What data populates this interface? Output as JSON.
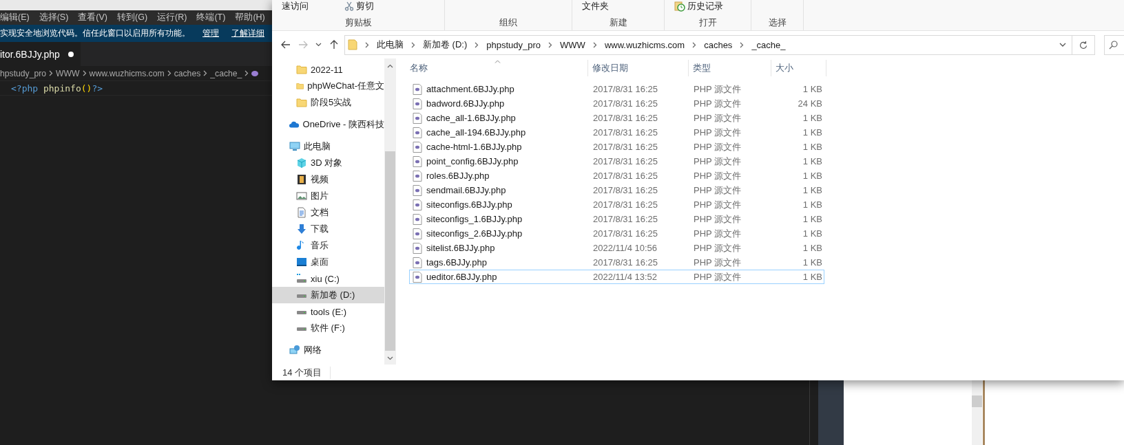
{
  "editor": {
    "menu": [
      "编辑(E)",
      "选择(S)",
      "查看(V)",
      "转到(G)",
      "运行(R)",
      "终端(T)",
      "帮助(H)"
    ],
    "trust_banner": {
      "message": "实现安全地浏览代码。信任此窗口以启用所有功能。",
      "links": [
        "管理",
        "了解详细"
      ]
    },
    "tabs": [
      {
        "label": "itor.6BJJy.php",
        "modified": true
      }
    ],
    "breadcrumb": [
      "hpstudy_pro",
      "WWW",
      "www.wuzhicms.com",
      "caches",
      "_cache_"
    ],
    "code_line": [
      {
        "text": "<?php",
        "kind": "tag"
      },
      {
        "text": " phpinfo",
        "kind": "func"
      },
      {
        "text": "()",
        "kind": "paren"
      },
      {
        "text": "?>",
        "kind": "tag"
      }
    ]
  },
  "explorer": {
    "ribbon": {
      "groups": [
        {
          "label": "剪贴板",
          "items": [
            {
              "kind": "text",
              "label": "速访问"
            },
            {
              "kind": "cut",
              "label": "剪切"
            }
          ]
        },
        {
          "label": "组织"
        },
        {
          "label": "新建",
          "items": [
            {
              "kind": "text",
              "label": "文件夹"
            }
          ]
        },
        {
          "label": "打开",
          "items": [
            {
              "kind": "history",
              "label": "历史记录"
            }
          ]
        },
        {
          "label": "选择"
        }
      ]
    },
    "address": {
      "path": [
        "此电脑",
        "新加卷 (D:)",
        "phpstudy_pro",
        "WWW",
        "www.wuzhicms.com",
        "caches",
        "_cache_"
      ]
    },
    "sidebar": {
      "pinned": [
        {
          "label": "2022-11",
          "kind": "folder",
          "selected": false
        },
        {
          "label": "phpWeChat-任意文",
          "kind": "folder",
          "selected": false
        },
        {
          "label": "阶段5实战",
          "kind": "folder",
          "selected": false
        }
      ],
      "locations": [
        {
          "label": "OneDrive - 陕西科技",
          "kind": "cloud",
          "selected": false
        },
        {
          "label": "此电脑",
          "kind": "pc",
          "selected": false,
          "children": [
            {
              "label": "3D 对象",
              "kind": "cube",
              "selected": false
            },
            {
              "label": "视频",
              "kind": "video",
              "selected": false
            },
            {
              "label": "图片",
              "kind": "picture",
              "selected": false
            },
            {
              "label": "文档",
              "kind": "document",
              "selected": false
            },
            {
              "label": "下载",
              "kind": "download",
              "selected": false
            },
            {
              "label": "音乐",
              "kind": "music",
              "selected": false
            },
            {
              "label": "桌面",
              "kind": "desktop",
              "selected": false
            },
            {
              "label": "xiu (C:)",
              "kind": "system_drive",
              "selected": false
            },
            {
              "label": "新加卷 (D:)",
              "kind": "drive",
              "selected": true
            },
            {
              "label": "tools (E:)",
              "kind": "drive",
              "selected": false
            },
            {
              "label": "软件 (F:)",
              "kind": "drive",
              "selected": false
            }
          ]
        },
        {
          "label": "网络",
          "kind": "network",
          "selected": false
        }
      ]
    },
    "columns": [
      "名称",
      "修改日期",
      "类型",
      "大小"
    ],
    "files": [
      {
        "name": "attachment.6BJJy.php",
        "modified": "2017/8/31 16:25",
        "type": "PHP 源文件",
        "size": "1 KB",
        "selected": false
      },
      {
        "name": "badword.6BJJy.php",
        "modified": "2017/8/31 16:25",
        "type": "PHP 源文件",
        "size": "24 KB",
        "selected": false
      },
      {
        "name": "cache_all-1.6BJJy.php",
        "modified": "2017/8/31 16:25",
        "type": "PHP 源文件",
        "size": "1 KB",
        "selected": false
      },
      {
        "name": "cache_all-194.6BJJy.php",
        "modified": "2017/8/31 16:25",
        "type": "PHP 源文件",
        "size": "1 KB",
        "selected": false
      },
      {
        "name": "cache-html-1.6BJJy.php",
        "modified": "2017/8/31 16:25",
        "type": "PHP 源文件",
        "size": "1 KB",
        "selected": false
      },
      {
        "name": "point_config.6BJJy.php",
        "modified": "2017/8/31 16:25",
        "type": "PHP 源文件",
        "size": "1 KB",
        "selected": false
      },
      {
        "name": "roles.6BJJy.php",
        "modified": "2017/8/31 16:25",
        "type": "PHP 源文件",
        "size": "1 KB",
        "selected": false
      },
      {
        "name": "sendmail.6BJJy.php",
        "modified": "2017/8/31 16:25",
        "type": "PHP 源文件",
        "size": "1 KB",
        "selected": false
      },
      {
        "name": "siteconfigs.6BJJy.php",
        "modified": "2017/8/31 16:25",
        "type": "PHP 源文件",
        "size": "1 KB",
        "selected": false
      },
      {
        "name": "siteconfigs_1.6BJJy.php",
        "modified": "2017/8/31 16:25",
        "type": "PHP 源文件",
        "size": "1 KB",
        "selected": false
      },
      {
        "name": "siteconfigs_2.6BJJy.php",
        "modified": "2017/8/31 16:25",
        "type": "PHP 源文件",
        "size": "1 KB",
        "selected": false
      },
      {
        "name": "sitelist.6BJJy.php",
        "modified": "2022/11/4 10:56",
        "type": "PHP 源文件",
        "size": "1 KB",
        "selected": false
      },
      {
        "name": "tags.6BJJy.php",
        "modified": "2017/8/31 16:25",
        "type": "PHP 源文件",
        "size": "1 KB",
        "selected": false
      },
      {
        "name": "ueditor.6BJJy.php",
        "modified": "2022/11/4 13:52",
        "type": "PHP 源文件",
        "size": "1 KB",
        "selected": true
      }
    ],
    "status": "14 个项目"
  }
}
